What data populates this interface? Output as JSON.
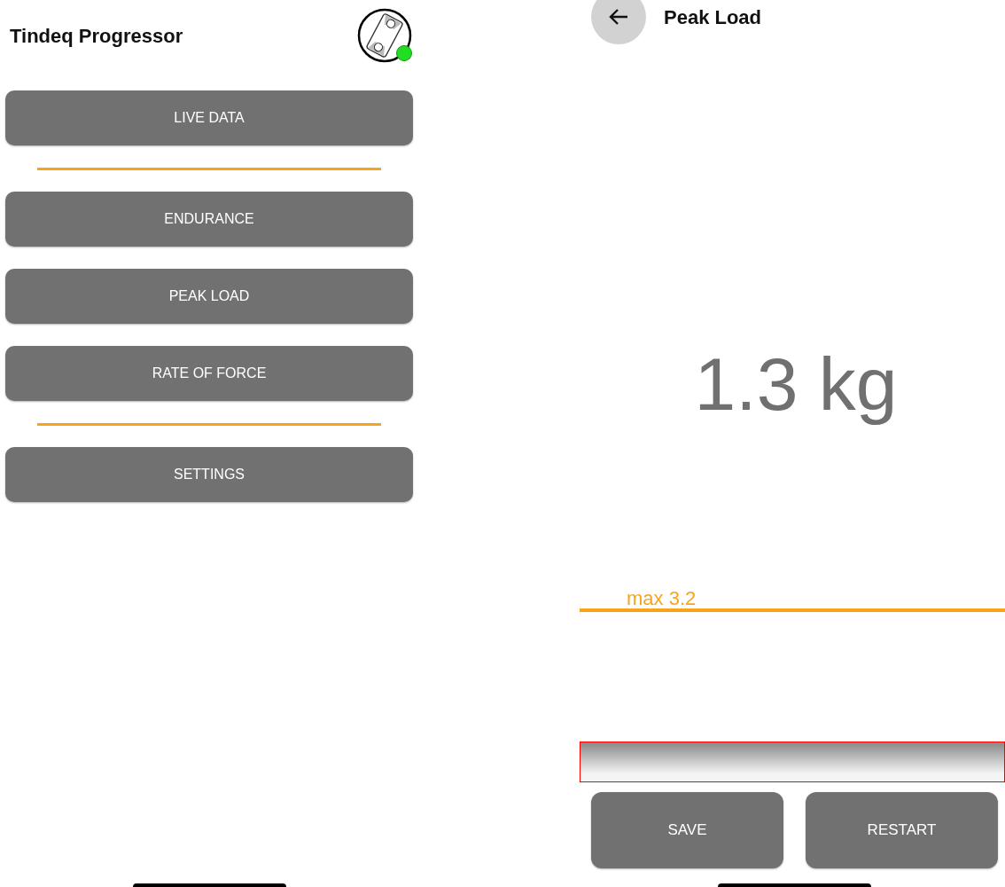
{
  "home_screen": {
    "title": "Tindeq Progressor",
    "device": {
      "connected": true
    },
    "menu_groups": [
      [
        "LIVE DATA"
      ],
      [
        "ENDURANCE",
        "PEAK LOAD",
        "RATE OF FORCE"
      ],
      [
        "SETTINGS"
      ]
    ]
  },
  "peak_load_screen": {
    "title": "Peak Load",
    "reading": "1.3 kg",
    "max_label": "max 3.2",
    "buttons": [
      "SAVE",
      "RESTART"
    ]
  }
}
